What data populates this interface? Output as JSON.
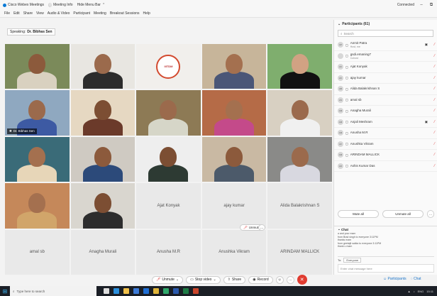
{
  "titlebar": {
    "app_name": "Cisco Webex Meetings",
    "meeting_info": "Meeting Info",
    "hide_menu": "Hide Menu Bar",
    "connected": "Connected"
  },
  "menu": [
    "File",
    "Edit",
    "Share",
    "View",
    "Audio & Video",
    "Participant",
    "Meeting",
    "Breakout Sessions",
    "Help"
  ],
  "speaking": {
    "label": "Speaking:",
    "name": "Dr. Bibhas Sen"
  },
  "tiles": [
    {
      "kind": "video",
      "bg": "#7b8a5a",
      "skin": "#8c5a3c",
      "shirt": "#d9d1c0"
    },
    {
      "kind": "video",
      "bg": "#e8e6e1",
      "skin": "#9b6a4c",
      "shirt": "#2c2c2c"
    },
    {
      "kind": "logo",
      "bg": "#f1efec",
      "text": "IIITDM"
    },
    {
      "kind": "video",
      "bg": "#c7b59a",
      "skin": "#a4704f",
      "shirt": "#4a5677"
    },
    {
      "kind": "video",
      "bg": "#7fae6e",
      "skin": "#d1a283",
      "shirt": "#111111"
    },
    {
      "kind": "video",
      "bg": "#8fa8c0",
      "skin": "#9b6a4c",
      "shirt": "#3d5aa3",
      "active": true,
      "tag": "Dr. Bibhas Sen"
    },
    {
      "kind": "video",
      "bg": "#e6d8c2",
      "skin": "#7c4e33",
      "shirt": "#6b3a2a"
    },
    {
      "kind": "video",
      "bg": "#8d7a55",
      "skin": "#9b6a4c",
      "shirt": "#d6d6c8"
    },
    {
      "kind": "video",
      "bg": "#b56b47",
      "skin": "#a4704f",
      "shirt": "#c44a8a"
    },
    {
      "kind": "video",
      "bg": "#d8d0c2",
      "skin": "#9b6a4c",
      "shirt": "#f0f0f0"
    },
    {
      "kind": "video",
      "bg": "#3a6b78",
      "skin": "#a4704f",
      "shirt": "#e7d6b8"
    },
    {
      "kind": "video",
      "bg": "#cfcac2",
      "skin": "#8c5a3c",
      "shirt": "#2c4a7a"
    },
    {
      "kind": "video",
      "bg": "#eeeeee",
      "skin": "#7c4e33",
      "shirt": "#2d3a33"
    },
    {
      "kind": "video",
      "bg": "#c9b9a3",
      "skin": "#8c5a3c",
      "shirt": "#4c5a6a"
    },
    {
      "kind": "video",
      "bg": "#8a8a88",
      "skin": "#9b6a4c",
      "shirt": "#d8d8e0"
    },
    {
      "kind": "video",
      "bg": "#c5885a",
      "skin": "#a4704f",
      "shirt": "#d1a56a"
    },
    {
      "kind": "video",
      "bg": "#d9d6cf",
      "skin": "#7c4e33",
      "shirt": "#2d2d2d"
    },
    {
      "kind": "empty",
      "name": "Ajat Konyak"
    },
    {
      "kind": "empty",
      "name": "ajay kumar"
    },
    {
      "kind": "empty",
      "name": "Alida Balakrishnan S"
    },
    {
      "kind": "empty",
      "name": "amal sb"
    },
    {
      "kind": "empty",
      "name": "Anagha Murali"
    },
    {
      "kind": "empty",
      "name": "Anusha M.R"
    },
    {
      "kind": "empty",
      "name": "Anushka Vikram"
    },
    {
      "kind": "empty",
      "name": "ARINDAM MALLICK"
    }
  ],
  "floating": {
    "unmute": "Unmute",
    "more": "…"
  },
  "controls": {
    "unmute": "Unmute",
    "stop_video": "Stop video",
    "share": "Share",
    "record": "Record",
    "emoji": "☺",
    "more": "…",
    "end": "✕"
  },
  "panel": {
    "title": "Participants (61)",
    "search_placeholder": "Search",
    "participants": [
      {
        "initials": "AP",
        "name": "Anmit Patra",
        "sub": "Host, me",
        "host": true
      },
      {
        "initials": "",
        "name": "gsdi.emaning7",
        "sub": "Cohost"
      },
      {
        "initials": "AK",
        "name": "Ajat Konyak"
      },
      {
        "initials": "AK",
        "name": "ajay kumar"
      },
      {
        "initials": "AB",
        "name": "Alida Balakrishnan S"
      },
      {
        "initials": "AS",
        "name": "amal sb"
      },
      {
        "initials": "AM",
        "name": "Anagha Murali"
      },
      {
        "initials": "AM",
        "name": "Anjali Meshram",
        "host": true
      },
      {
        "initials": "AM",
        "name": "Anusha M.R"
      },
      {
        "initials": "AV",
        "name": "Anushka Vikram"
      },
      {
        "initials": "AM",
        "name": "ARINDAM MALLICK"
      },
      {
        "initials": "AD",
        "name": "Ashis Kumar Das"
      }
    ],
    "mute_all": "Mute all",
    "unmute_all": "Unmute all",
    "more": "…"
  },
  "chat": {
    "title": "Chat",
    "messages": [
      "a and your mam",
      "from Brad singh to everyone  3:11PM",
      "thanks mam",
      "from geetajit saikia to everyone  3:11PM",
      "thank u mam"
    ],
    "to_label": "To:",
    "to_value": "Everyone",
    "input_placeholder": "Enter chat message here"
  },
  "bottom_links": {
    "participants": "Participants",
    "chat": "Chat"
  },
  "taskbar": {
    "search_placeholder": "Type here to search",
    "lang": "ENG",
    "time": "15:11"
  }
}
